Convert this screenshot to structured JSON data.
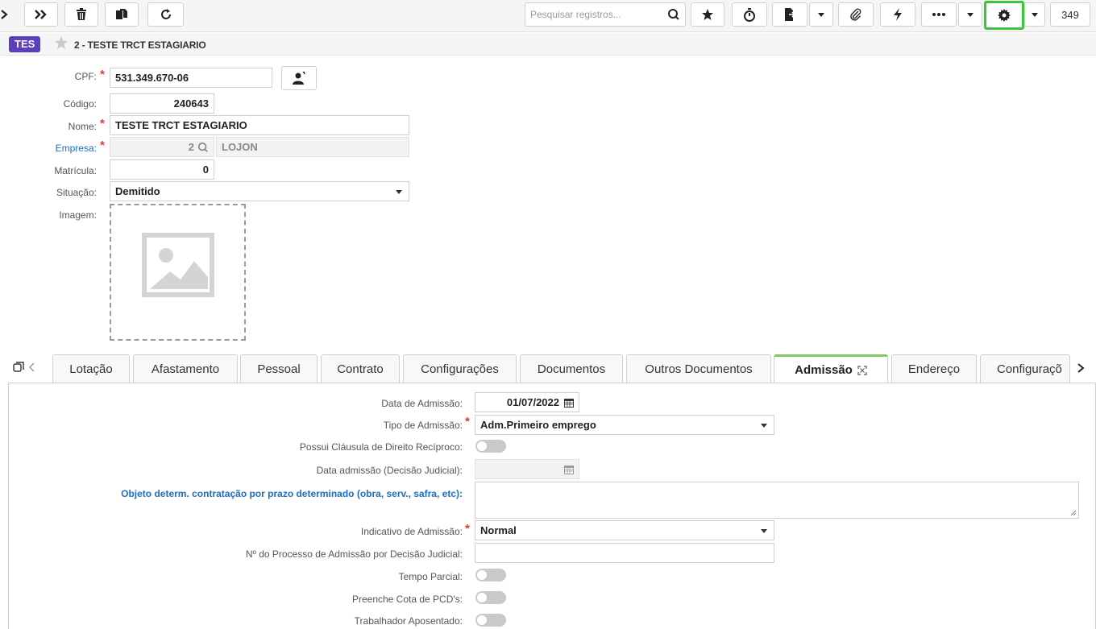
{
  "toolbar": {
    "search_placeholder": "Pesquisar registros...",
    "record_count": "349"
  },
  "header": {
    "entity_badge": "TES",
    "record_title": "2 - TESTE TRCT ESTAGIARIO"
  },
  "form": {
    "cpf": {
      "label": "CPF:",
      "value": "531.349.670-06"
    },
    "codigo": {
      "label": "Código:",
      "value": "240643"
    },
    "nome": {
      "label": "Nome:",
      "value": "TESTE TRCT ESTAGIARIO"
    },
    "empresa": {
      "label": "Empresa:",
      "code": "2",
      "name": "LOJON"
    },
    "matricula": {
      "label": "Matrícula:",
      "value": "0"
    },
    "situacao": {
      "label": "Situação:",
      "value": "Demitido"
    },
    "imagem": {
      "label": "Imagem:"
    }
  },
  "tabs": [
    {
      "label": "Lotação"
    },
    {
      "label": "Afastamento"
    },
    {
      "label": "Pessoal"
    },
    {
      "label": "Contrato"
    },
    {
      "label": "Configurações"
    },
    {
      "label": "Documentos"
    },
    {
      "label": "Outros Documentos"
    },
    {
      "label": "Admissão"
    },
    {
      "label": "Endereço"
    },
    {
      "label": "Configuraçõ"
    }
  ],
  "admissao": {
    "data_admissao": {
      "label": "Data de Admissão:",
      "value": "01/07/2022"
    },
    "tipo_admissao": {
      "label": "Tipo de Admissão:",
      "value": "Adm.Primeiro emprego"
    },
    "clausula": {
      "label": "Possui Cláusula de Direito Recíproco:"
    },
    "data_judicial": {
      "label": "Data admissão (Decisão Judicial):",
      "value": ""
    },
    "objeto": {
      "label": "Objeto determ. contratação por prazo determinado (obra, serv., safra, etc):",
      "value": ""
    },
    "indicativo": {
      "label": "Indicativo de Admissão:",
      "value": "Normal"
    },
    "processo": {
      "label": "Nº do Processo de Admissão por Decisão Judicial:",
      "value": ""
    },
    "tempo_parcial": {
      "label": "Tempo Parcial:"
    },
    "cota_pcd": {
      "label": "Preenche Cota de PCD's:"
    },
    "aposentado": {
      "label": "Trabalhador Aposentado:"
    }
  },
  "colors": {
    "accent_green": "#3cc43c",
    "badge_purple": "#5b3fbf",
    "required_red": "#e53935",
    "link_blue": "#1a6fd1"
  }
}
